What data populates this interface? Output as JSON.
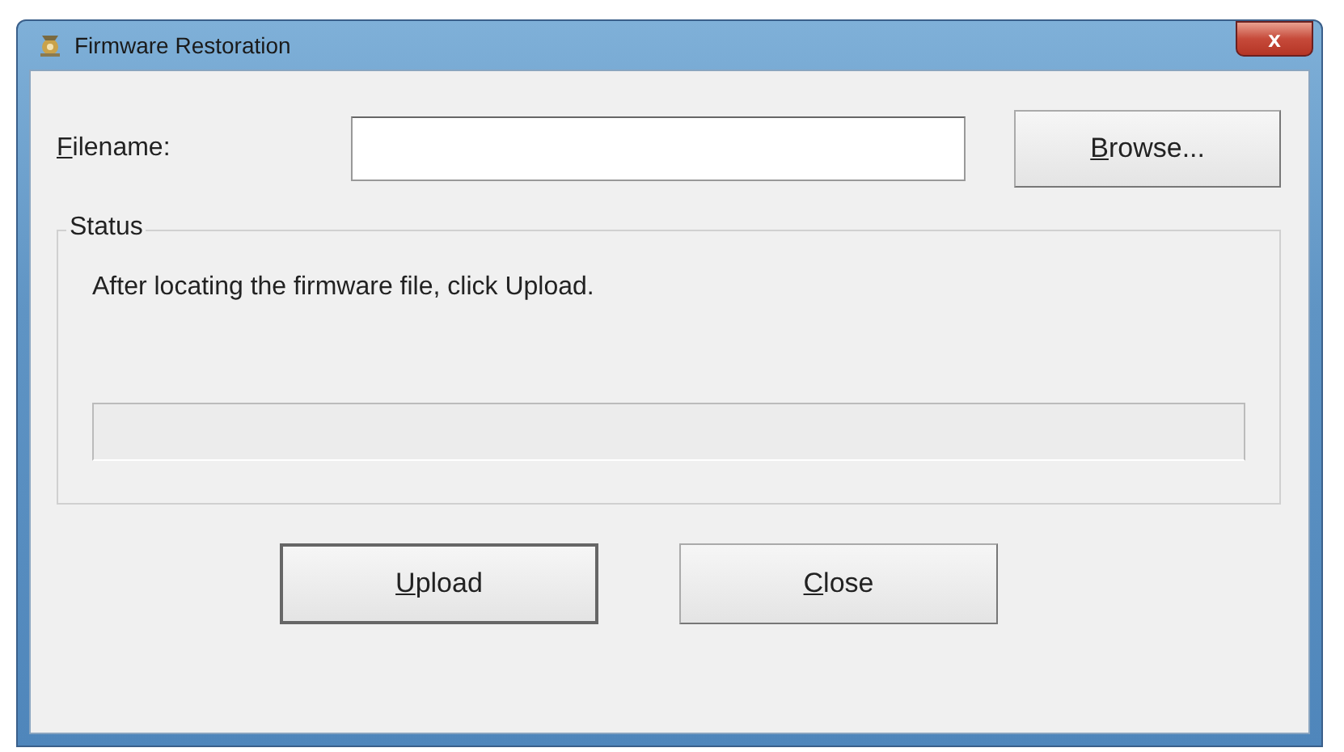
{
  "window": {
    "title": "Firmware Restoration",
    "close_label": "x"
  },
  "filename": {
    "label": {
      "accel": "F",
      "rest": "ilename:"
    }
  },
  "browse_button": {
    "accel": "B",
    "rest": "rowse..."
  },
  "status": {
    "legend": "Status",
    "message": "After locating the firmware file, click Upload.",
    "progress": {
      "level": 0
    }
  },
  "buttons": [
    {
      "accel": "U",
      "rest": "pload",
      "kind": "default"
    },
    {
      "accel": "C",
      "rest": "lose",
      "kind": "normal"
    }
  ]
}
